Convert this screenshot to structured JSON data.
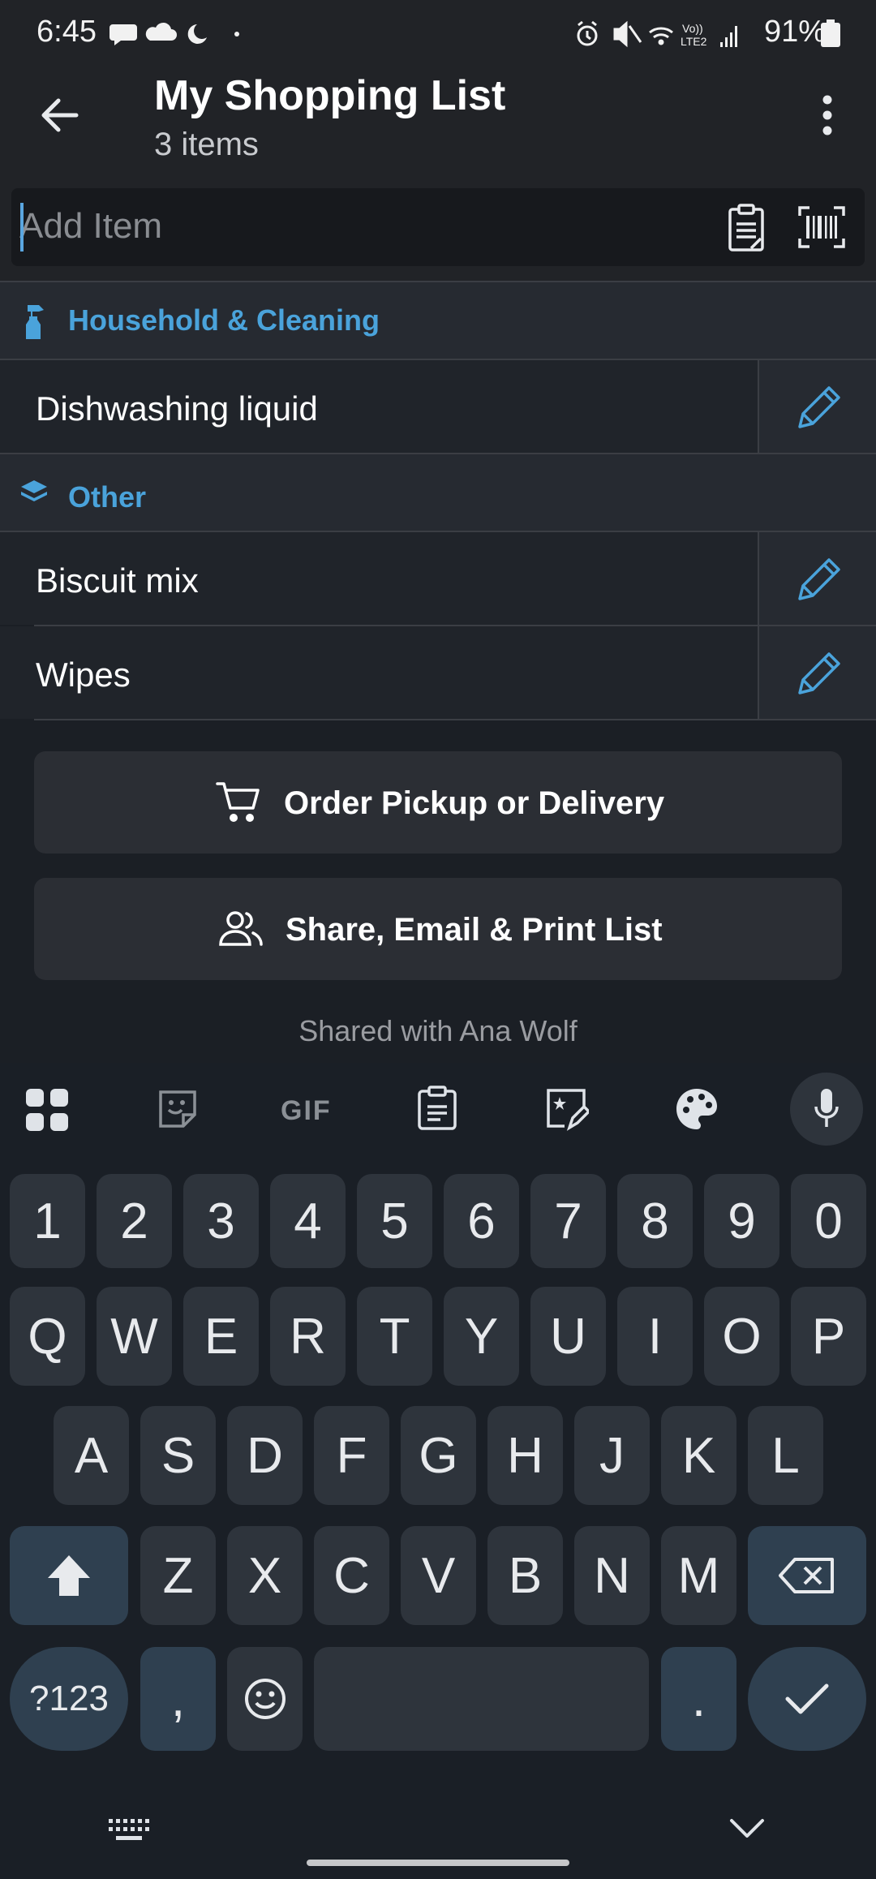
{
  "status_bar": {
    "time": "6:45",
    "battery": "91%"
  },
  "header": {
    "title": "My Shopping List",
    "subtitle": "3 items"
  },
  "add_item": {
    "placeholder": "Add Item",
    "value": ""
  },
  "categories": [
    {
      "name": "Household & Cleaning",
      "icon": "spray-bottle-icon",
      "items": [
        "Dishwashing liquid"
      ]
    },
    {
      "name": "Other",
      "icon": "layers-icon",
      "items": [
        "Biscuit mix",
        "Wipes"
      ]
    }
  ],
  "buttons": {
    "order": "Order Pickup or Delivery",
    "share": "Share, Email & Print List"
  },
  "shared_with": "Shared with Ana Wolf",
  "keyboard": {
    "toolbar": [
      "apps-icon",
      "sticker-icon",
      "GIF",
      "clipboard-icon",
      "text-effect-icon",
      "palette-icon",
      "microphone-icon"
    ],
    "row_numbers": [
      "1",
      "2",
      "3",
      "4",
      "5",
      "6",
      "7",
      "8",
      "9",
      "0"
    ],
    "row_1": [
      "Q",
      "W",
      "E",
      "R",
      "T",
      "Y",
      "U",
      "I",
      "O",
      "P"
    ],
    "row_2": [
      "A",
      "S",
      "D",
      "F",
      "G",
      "H",
      "J",
      "K",
      "L"
    ],
    "row_3": [
      "Z",
      "X",
      "C",
      "V",
      "B",
      "N",
      "M"
    ],
    "symbols_key": "?123",
    "comma": ",",
    "period": "."
  },
  "colors": {
    "accent": "#4aa3db",
    "background": "#20242a",
    "keyboard": "#1a1f26"
  }
}
